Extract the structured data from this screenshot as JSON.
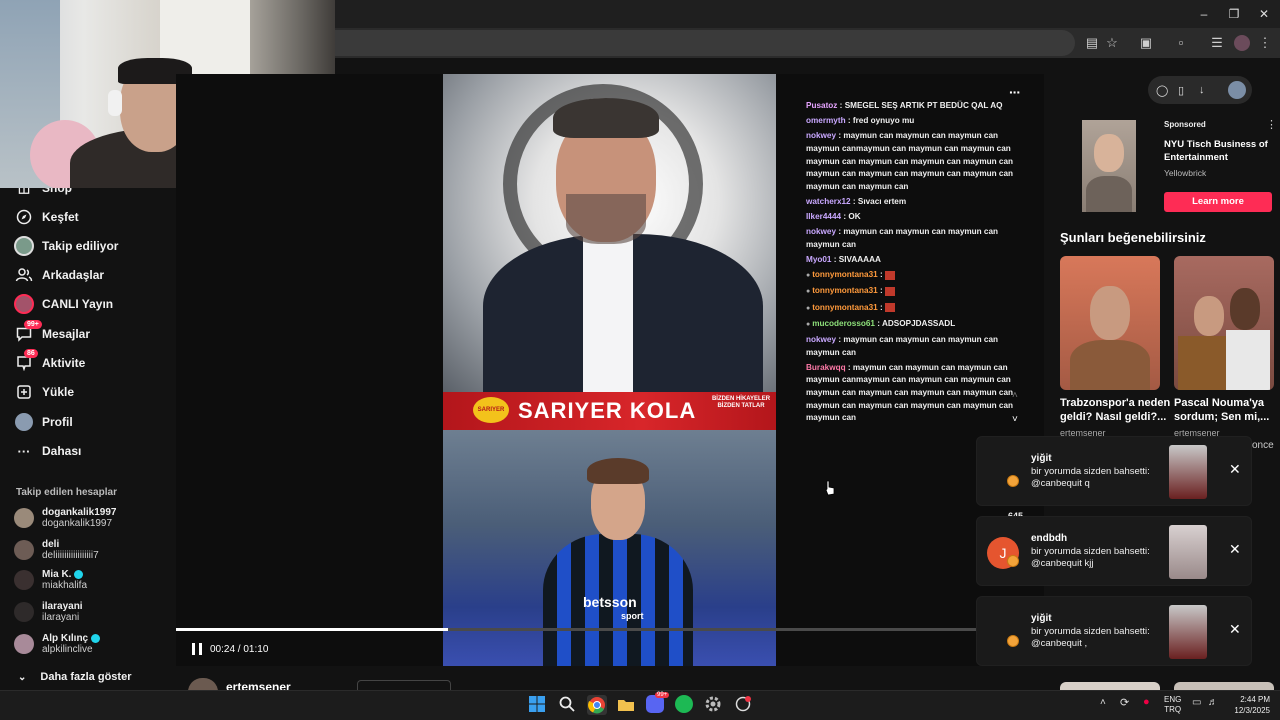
{
  "sidebar": {
    "items": [
      {
        "label": "Shop",
        "icon": "shop-icon"
      },
      {
        "label": "Keşfet",
        "icon": "compass-icon"
      },
      {
        "label": "Takip ediliyor",
        "icon": "following-icon"
      },
      {
        "label": "Arkadaşlar",
        "icon": "friends-icon"
      },
      {
        "label": "CANLI Yayın",
        "icon": "live-icon"
      },
      {
        "label": "Mesajlar",
        "icon": "messages-icon",
        "badge": "99+"
      },
      {
        "label": "Aktivite",
        "icon": "activity-icon",
        "badge": "86"
      },
      {
        "label": "Yükle",
        "icon": "upload-icon"
      },
      {
        "label": "Profil",
        "icon": "profile-icon"
      },
      {
        "label": "Dahası",
        "icon": "more-icon"
      }
    ],
    "followed_title": "Takip edilen hesaplar",
    "followed": [
      {
        "name": "dogankalik1997",
        "handle": "dogankalik1997",
        "verified": false
      },
      {
        "name": "deli",
        "handle": "deliiiiiiiiiiiiiiiii7",
        "verified": false
      },
      {
        "name": "Mia K.",
        "handle": "miakhalifa",
        "verified": true
      },
      {
        "name": "ilarayani",
        "handle": "ilarayani",
        "verified": false
      },
      {
        "name": "Alp Kılınç",
        "handle": "alpkilinclive",
        "verified": true
      }
    ],
    "show_more": "Daha fazla göster"
  },
  "video": {
    "banner": "SARIYER KOLA",
    "banner_small": "SARIYER",
    "banner_side": "BİZDEN HİKAYELER BİZDEN TATLAR",
    "sponsor": "betsson",
    "sponsor_small": "sport",
    "time": "00:24 / 01:10",
    "progress": 0.34,
    "creator": "ertemsener"
  },
  "chat": [
    {
      "user": "Pusatoz",
      "text": "SMEGEL SEŞ ARTIK PT BEDÜC QAL AQ",
      "color": "#e6a4ff",
      "badge": false
    },
    {
      "user": "omermyth",
      "text": "fred oynuyo mu",
      "color": "#c9a8ff",
      "badge": false
    },
    {
      "user": "nokwey",
      "text": "maymun can maymun can maymun can maymun canmaymun can maymun can maymun can maymun can maymun can maymun can maymun can maymun can maymun can maymun can maymun can maymun can maymun can",
      "color": "#c9a8ff",
      "badge": false
    },
    {
      "user": "watcherx12",
      "text": "Sıvacı ertem",
      "color": "#c9a8ff",
      "badge": false
    },
    {
      "user": "Ilker4444",
      "text": "OK",
      "color": "#c9a8ff",
      "badge": false
    },
    {
      "user": "nokwey",
      "text": "maymun can maymun can maymun can maymun can",
      "color": "#c9a8ff",
      "badge": false
    },
    {
      "user": "Myo01",
      "text": "SIVAAAAA",
      "color": "#c9a8ff",
      "badge": false
    },
    {
      "user": "tonnymontana31",
      "text": "",
      "color": "#ff9a3c",
      "badge": true
    },
    {
      "user": "tonnymontana31",
      "text": "",
      "color": "#ff9a3c",
      "badge": true
    },
    {
      "user": "tonnymontana31",
      "text": "",
      "color": "#ff9a3c",
      "badge": true
    },
    {
      "user": "mucoderosso61",
      "text": "ADSOPJDASSADL",
      "color": "#8ee07a",
      "badge": true
    },
    {
      "user": "nokwey",
      "text": "maymun can maymun can maymun can maymun can",
      "color": "#c9a8ff",
      "badge": false
    },
    {
      "user": "Burakwqq",
      "text": "maymun can maymun can maymun can maymun canmaymun can maymun can maymun can maymun can maymun can maymun can maymun can maymun can maymun can maymun can maymun can maymun can",
      "color": "#ff7aa8",
      "badge": false
    }
  ],
  "ad": {
    "sponsored": "Sponsored",
    "title": "NYU Tisch Business of Entertainment",
    "advertiser": "Yellowbrick",
    "cta": "Learn more"
  },
  "recommend": {
    "title": "Şunları beğenebilirsiniz",
    "items": [
      {
        "title": "Trabzonspor'a neden geldi? Nasıl geldi?...",
        "author": "ertemsener"
      },
      {
        "title": "Pascal Nouma'ya sordum; Sen mi,...",
        "author": "ertemsener"
      }
    ],
    "extra_text": "once",
    "count_hint": "645"
  },
  "notifications": [
    {
      "name": "yiğit",
      "text": "bir yorumda sizden bahsetti: @canbequit q",
      "avatar_letter": ""
    },
    {
      "name": "endbdh",
      "text": "bir yorumda sizden bahsetti: @canbequit kjj",
      "avatar_letter": "J"
    },
    {
      "name": "yiğit",
      "text": "bir yorumda sizden bahsetti: @canbequit ,",
      "avatar_letter": ""
    }
  ],
  "taskbar": {
    "lang_top": "ENG",
    "lang_bottom": "TRQ",
    "time": "2:44 PM",
    "date": "12/3/2025",
    "chat_badge": "99+"
  }
}
